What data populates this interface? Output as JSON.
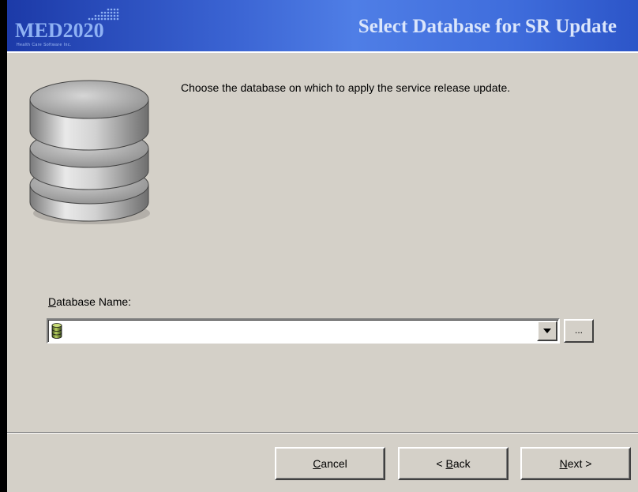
{
  "header": {
    "logo_text": "MED2020",
    "logo_tagline": "Health Care Software Inc.",
    "title": "Select Database for SR Update",
    "gradient_colors": [
      "#1c3aa8",
      "#4f7ee6",
      "#2c55c8"
    ]
  },
  "main": {
    "instruction": "Choose the database on which to apply the service release update.",
    "database_image_icon": "database-stack-icon"
  },
  "database_field": {
    "label_prefix": "",
    "label_accel": "D",
    "label_rest": "atabase Name:",
    "value": "",
    "item_icon": "database-icon",
    "dropdown_icon": "chevron-down-icon",
    "browse_label": "..."
  },
  "buttons": {
    "cancel_accel": "C",
    "cancel_rest": "ancel",
    "back_prefix": "< ",
    "back_accel": "B",
    "back_rest": "ack",
    "next_accel": "N",
    "next_rest": "ext >"
  },
  "colors": {
    "window_background": "#d4d0c8",
    "header_title": "#dbe6fb",
    "logo_text": "#8fb2f4"
  }
}
